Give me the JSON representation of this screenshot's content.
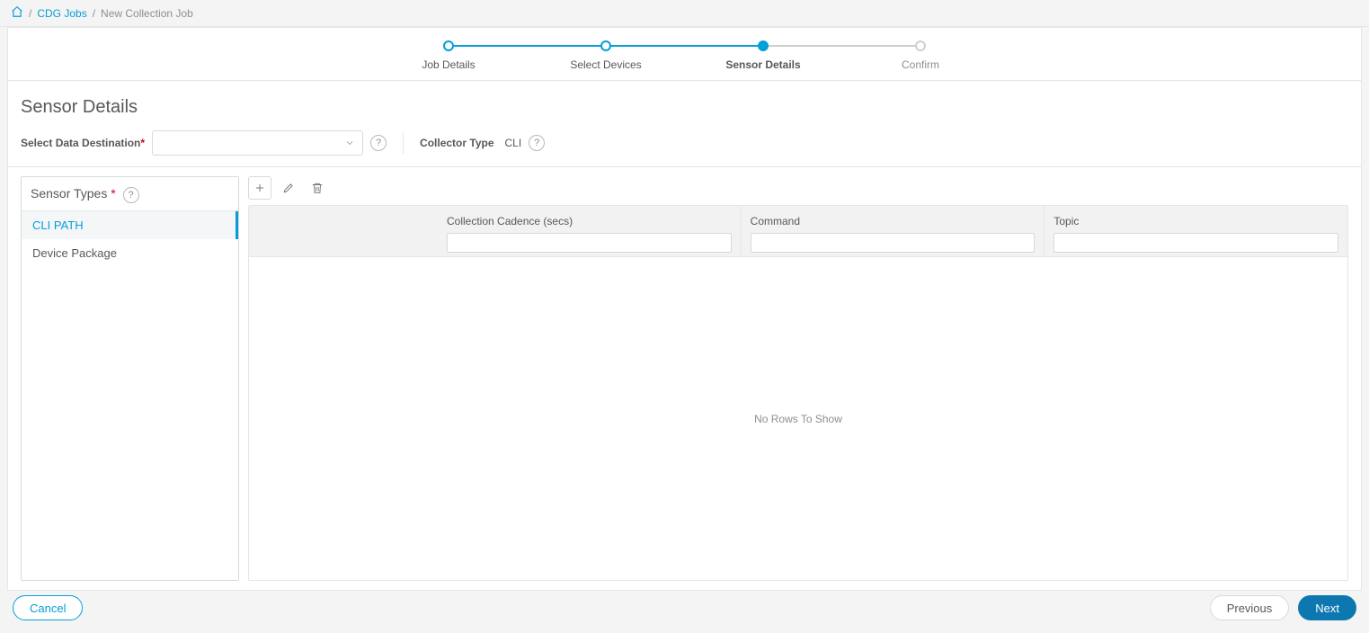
{
  "breadcrumb": {
    "home_aria": "home",
    "link1": "CDG Jobs",
    "current": "New Collection Job"
  },
  "stepper": {
    "steps": [
      {
        "label": "Job Details"
      },
      {
        "label": "Select Devices"
      },
      {
        "label": "Sensor Details"
      },
      {
        "label": "Confirm"
      }
    ],
    "active_index": 2
  },
  "page_title": "Sensor Details",
  "form": {
    "dest_label": "Select Data Destination",
    "dest_value": "",
    "collector_type_label": "Collector Type",
    "collector_type_value": "CLI"
  },
  "sensor_types": {
    "heading": "Sensor Types",
    "items": [
      {
        "label": "CLI PATH",
        "active": true
      },
      {
        "label": "Device Package",
        "active": false
      }
    ]
  },
  "grid": {
    "columns": [
      {
        "label": "Collection Cadence (secs)"
      },
      {
        "label": "Command"
      },
      {
        "label": "Topic"
      }
    ],
    "empty_text": "No Rows To Show"
  },
  "footer": {
    "cancel": "Cancel",
    "previous": "Previous",
    "next": "Next"
  }
}
